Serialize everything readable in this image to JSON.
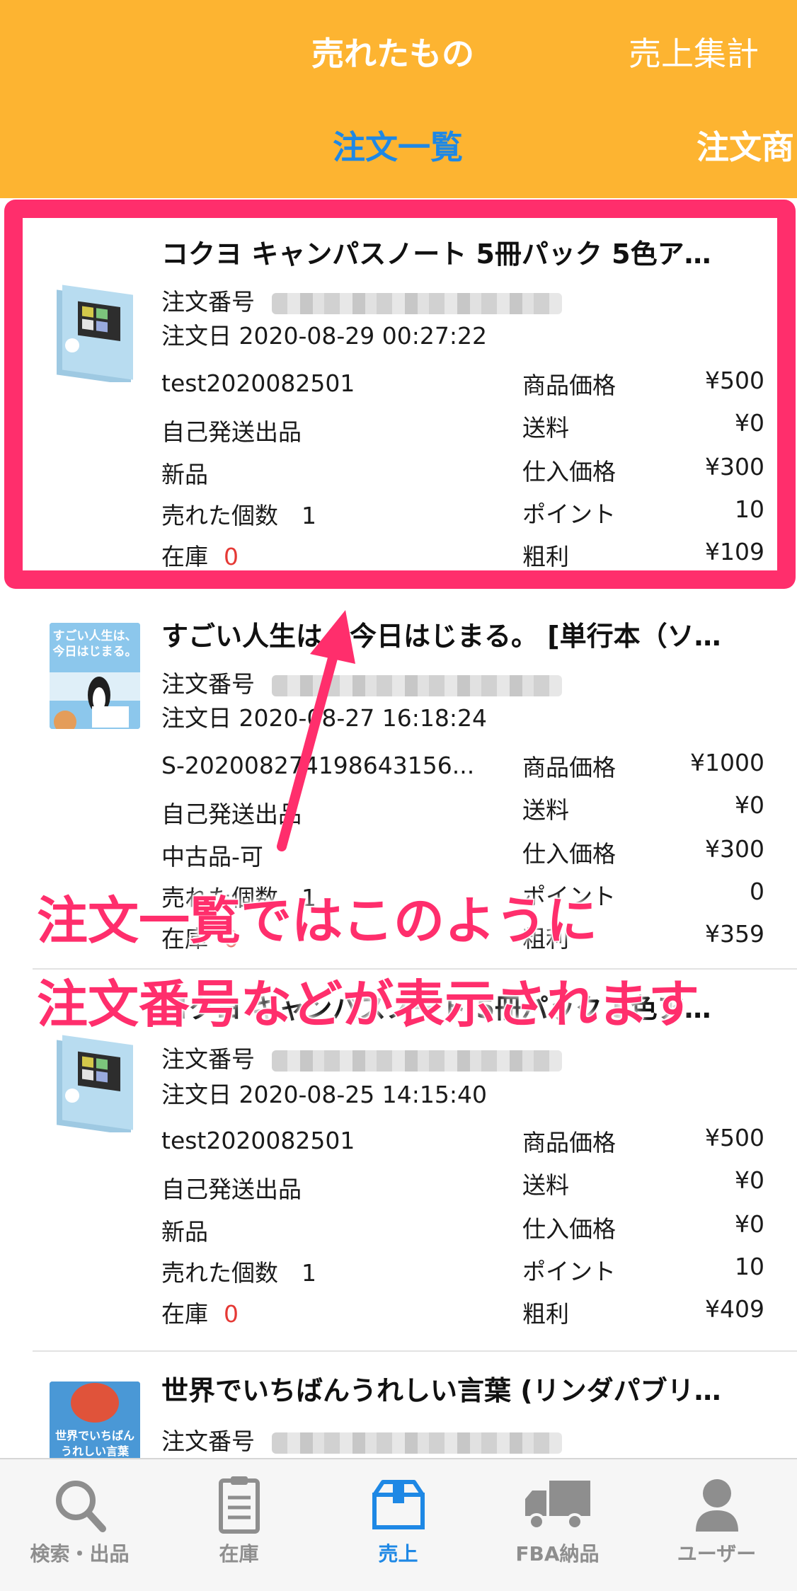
{
  "header": {
    "top_tabs": [
      {
        "label": "売れたもの",
        "active": true
      },
      {
        "label": "売上集計",
        "active": false
      }
    ],
    "sub_tabs": [
      {
        "label": "注文一覧",
        "active": true
      },
      {
        "label": "注文商",
        "active": false
      }
    ]
  },
  "labels": {
    "order_number": "注文番号",
    "order_date_prefix": "注文日",
    "price": "商品価格",
    "shipping": "送料",
    "cost": "仕入価格",
    "points": "ポイント",
    "profit": "粗利",
    "sold_qty": "売れた個数",
    "stock": "在庫"
  },
  "orders": [
    {
      "title": "コクヨ キャンパスノート 5冊パック 5色ア…",
      "date": "注文日 2020-08-29 00:27:22",
      "sku": "test2020082501",
      "shipping_method": "自己発送出品",
      "condition": "新品",
      "sold_qty": "売れた個数　1",
      "stock_value": "0",
      "price": "¥500",
      "shipping": "¥0",
      "cost": "¥300",
      "points": "10",
      "profit": "¥109"
    },
    {
      "title": "すごい人生は、今日はじまる。 [単行本（ソ…",
      "date": "注文日 2020-08-27 16:18:24",
      "sku": "S-20200827419864315​6...",
      "shipping_method": "自己発送出品",
      "condition": "中古品-可",
      "sold_qty": "売れた個数　1",
      "stock_value": "0",
      "price": "¥1000",
      "shipping": "¥0",
      "cost": "¥300",
      "points": "0",
      "profit": "¥359"
    },
    {
      "title": "コクヨ キャンパスノート 5冊パック 5色ア…",
      "date": "注文日 2020-08-25 14:15:40",
      "sku": "test2020082501",
      "shipping_method": "自己発送出品",
      "condition": "新品",
      "sold_qty": "売れた個数　1",
      "stock_value": "0",
      "price": "¥500",
      "shipping": "¥0",
      "cost": "¥0",
      "points": "10",
      "profit": "¥409"
    },
    {
      "title": "世界でいちばんうれしい言葉 (リンダパブリ…"
    }
  ],
  "book_covers": {
    "book1_line1": "すごい人生は、",
    "book1_line2": "今日はじまる。",
    "book2_line1": "世界でいちばん",
    "book2_line2": "うれしい言葉"
  },
  "annotation": {
    "line1": "注文一覧ではこのように",
    "line2": "注文番号などが表示されます",
    "color": "#FF2E6C"
  },
  "nav": [
    {
      "label": "検索・出品",
      "icon": "search-icon",
      "active": false
    },
    {
      "label": "在庫",
      "icon": "clipboard-icon",
      "active": false
    },
    {
      "label": "売上",
      "icon": "box-icon",
      "active": true
    },
    {
      "label": "FBA納品",
      "icon": "truck-icon",
      "active": false
    },
    {
      "label": "ユーザー",
      "icon": "user-icon",
      "active": false
    }
  ],
  "colors": {
    "header_bg": "#FDB431",
    "accent_blue": "#1E88E5",
    "highlight_pink": "#FF2E6C",
    "stock_red": "#e53935"
  }
}
